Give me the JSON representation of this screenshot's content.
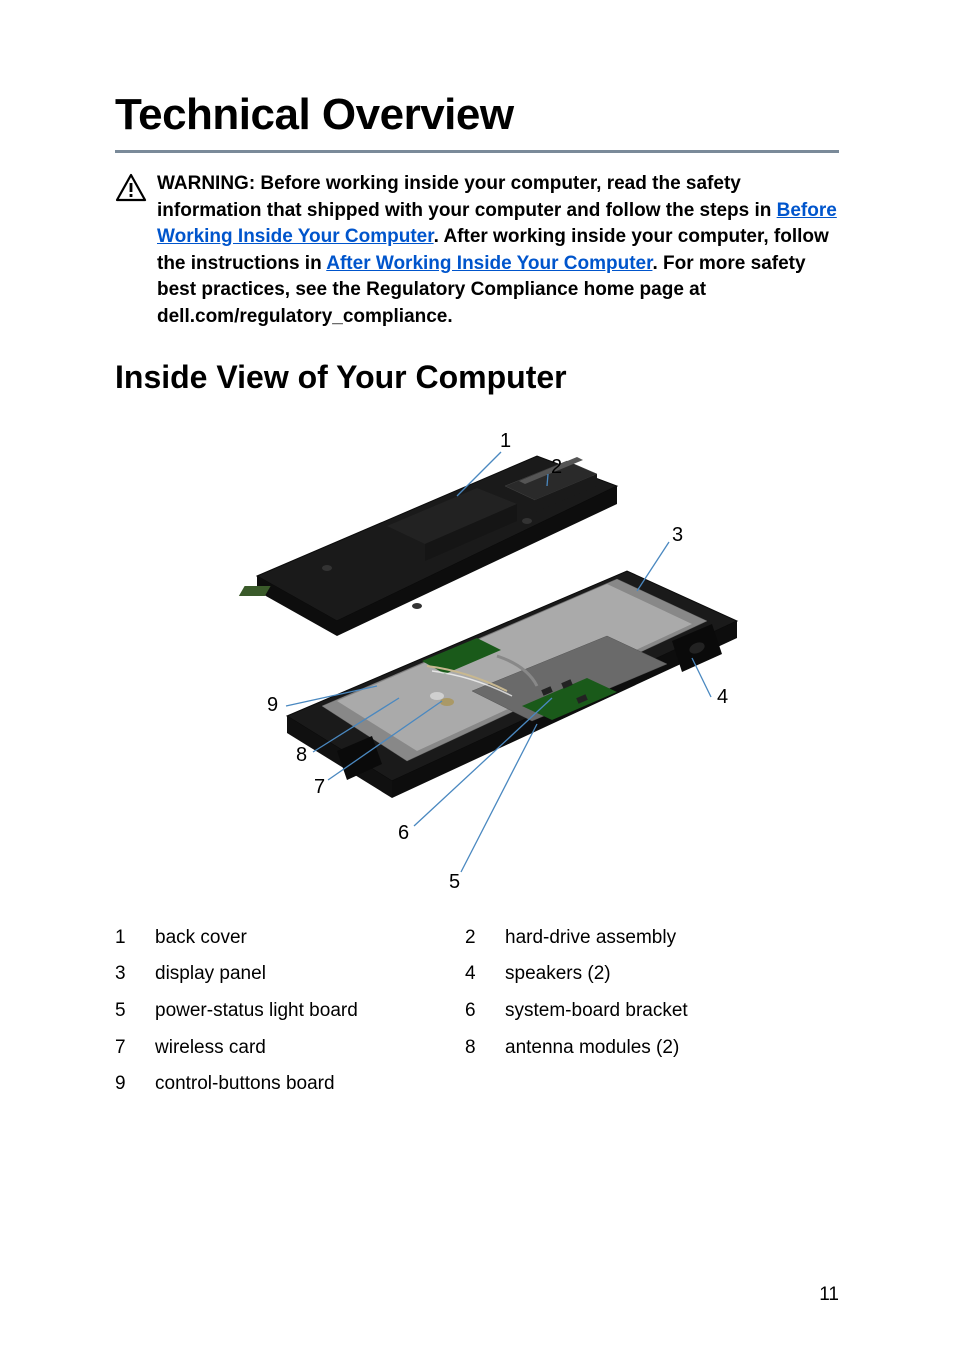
{
  "page_title": "Technical Overview",
  "warning": {
    "prefix": "WARNING: Before working inside your computer, read the safety information that shipped with your computer and follow the steps in ",
    "link1": "Before Working Inside Your Computer",
    "mid1": ". After working inside your computer, follow the instructions in ",
    "link2": "After Working Inside Your Computer",
    "suffix": ". For more safety best practices, see the Regulatory Compliance home page at dell.com/regulatory_compliance."
  },
  "subtitle": "Inside View of Your Computer",
  "callouts": {
    "c1": "1",
    "c2": "2",
    "c3": "3",
    "c4": "4",
    "c5": "5",
    "c6": "6",
    "c7": "7",
    "c8": "8",
    "c9": "9"
  },
  "parts": {
    "n1": "1",
    "l1": "back cover",
    "n2": "2",
    "l2": "hard-drive assembly",
    "n3": "3",
    "l3": "display panel",
    "n4": "4",
    "l4": "speakers (2)",
    "n5": "5",
    "l5": "power-status light board",
    "n6": "6",
    "l6": "system-board bracket",
    "n7": "7",
    "l7": "wireless card",
    "n8": "8",
    "l8": "antenna modules (2)",
    "n9": "9",
    "l9": "control-buttons board"
  },
  "page_number": "11"
}
